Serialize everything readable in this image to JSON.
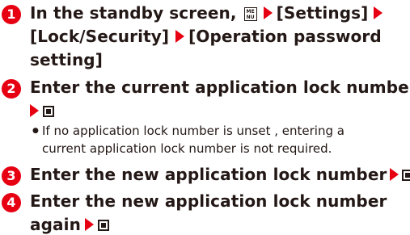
{
  "colors": {
    "accent": "#e60012",
    "text": "#231815",
    "step_number_bg": "#e60012"
  },
  "steps": [
    {
      "number": "1",
      "lines": [
        "In the standby screen,",
        "[Settings]",
        "[Lock/Security]",
        "[Operation password",
        "setting]"
      ],
      "menu_icon_label_top": "ME",
      "menu_icon_label_bottom": "NU"
    },
    {
      "number": "2",
      "lines": [
        "Enter the current application lock number"
      ]
    },
    {
      "number": "3",
      "lines": [
        "Enter the new application lock number"
      ]
    },
    {
      "number": "4",
      "lines": [
        "Enter the new application lock number",
        "again"
      ]
    }
  ],
  "note": {
    "bullet": "●",
    "lines": [
      "If no application lock number is unset , entering a",
      "current application lock number is not required."
    ]
  }
}
